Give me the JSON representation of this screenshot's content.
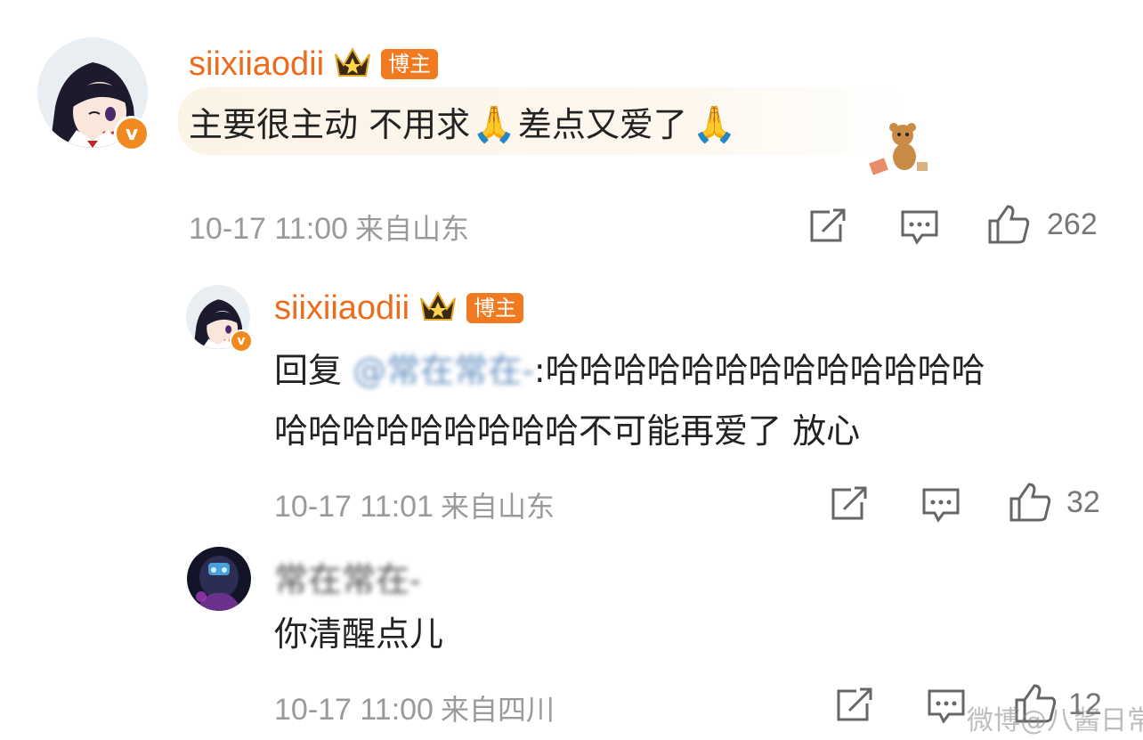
{
  "comments": [
    {
      "username": "siixiiaodii",
      "badge": "博主",
      "verified_mark": "v",
      "text": "主要很主动 不用求",
      "emoji": "🙏",
      "text2": "差点又爱了",
      "time": "10-17 11:00",
      "location": "来自山东",
      "likes": "262"
    },
    {
      "username": "siixiiaodii",
      "badge": "博主",
      "verified_mark": "v",
      "reply_prefix": "回复",
      "mention": "@常在常在-",
      "text_line1": ":哈哈哈哈哈哈哈哈哈哈哈哈哈",
      "text_line2": "哈哈哈哈哈哈哈哈哈不可能再爱了 放心",
      "time": "10-17 11:01",
      "location": "来自山东",
      "likes": "32"
    },
    {
      "username": "常在常在-",
      "text": "你清醒点儿",
      "time": "10-17 11:00",
      "location": "来自四川",
      "likes": "12"
    }
  ],
  "watermark": "微博@八酱日常",
  "colors": {
    "accent": "#ec6c1c",
    "mention": "#4a7fb5",
    "meta": "#9a9a9a"
  }
}
